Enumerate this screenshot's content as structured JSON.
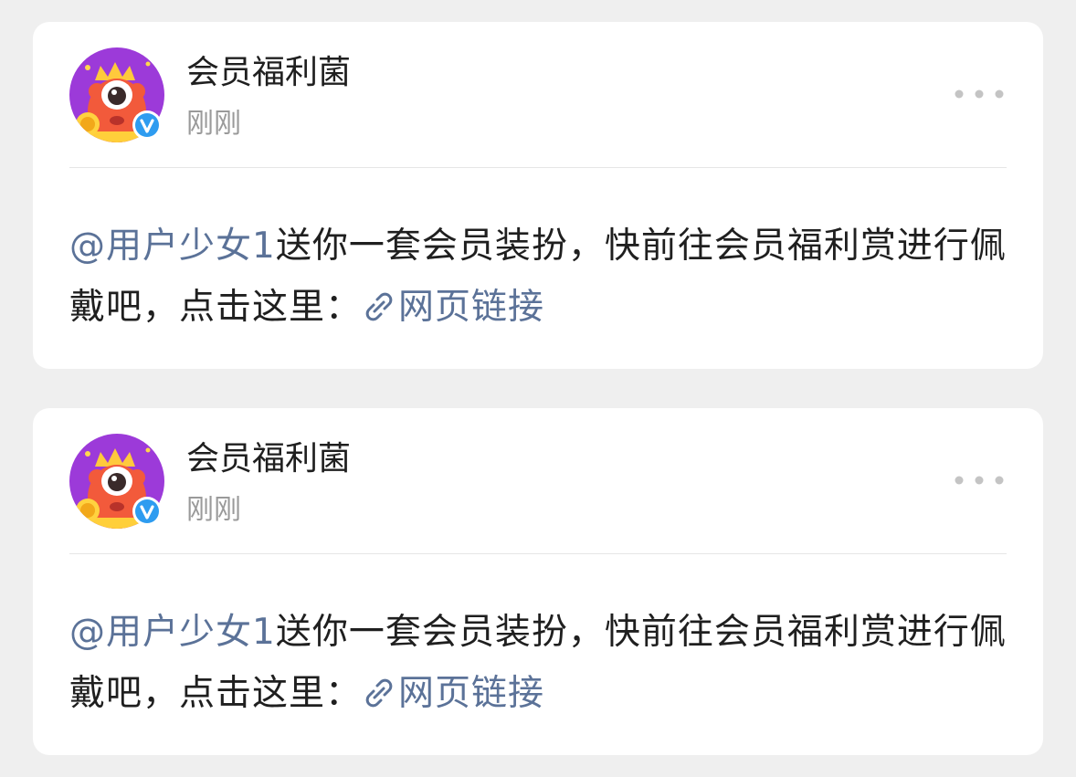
{
  "colors": {
    "background": "#efefef",
    "card": "#ffffff",
    "link": "#5b7298",
    "text": "#1f1f1f",
    "muted": "#9a9a9a",
    "verified": "#2e9cf0",
    "avatar_bg": "#9c3ad9"
  },
  "posts": [
    {
      "author": "会员福利菌",
      "time": "刚刚",
      "avatar_icon": "red-monster-mascot",
      "badge_icon": "verified-v-badge",
      "more_icon": "three-dots-icon",
      "mention": "@用户少女1",
      "text_before_link": "送你一套会员装扮，快前往会员福利赏进行佩戴吧，点击这里：",
      "link_icon": "link-chain-icon",
      "link_text": "网页链接"
    },
    {
      "author": "会员福利菌",
      "time": "刚刚",
      "avatar_icon": "red-monster-mascot",
      "badge_icon": "verified-v-badge",
      "more_icon": "three-dots-icon",
      "mention": "@用户少女1",
      "text_before_link": "送你一套会员装扮，快前往会员福利赏进行佩戴吧，点击这里：",
      "link_icon": "link-chain-icon",
      "link_text": "网页链接"
    }
  ]
}
